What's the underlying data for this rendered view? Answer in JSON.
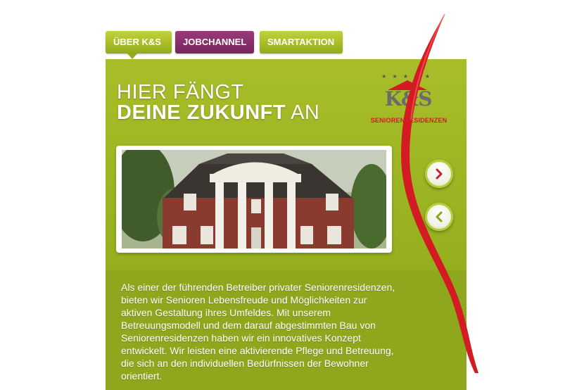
{
  "tabs": [
    {
      "label": "ÜBER K&S",
      "color": "#a5bb2a",
      "active": true
    },
    {
      "label": "JOBCHANNEL",
      "color": "#87306a",
      "active": false
    },
    {
      "label": "SMARTAKTION",
      "color": "#a5bb2a",
      "active": false
    }
  ],
  "headline": {
    "line1": "HIER FÄNGT",
    "line2_bold": "DEINE ZUKUNFT",
    "line2_rest": "AN"
  },
  "logo": {
    "stars": "★ ★ ★ ★ ★",
    "letters": "K&S",
    "subtitle": "SENIORENRESIDENZEN"
  },
  "carousel": {
    "next_icon": "chevron-right-icon",
    "prev_icon": "chevron-left-icon",
    "image": "building-photo"
  },
  "body_text": "Als einer der führenden Betreiber privater Seniorenresidenzen, bieten wir Senioren Lebensfreude und Möglichkeiten zur aktiven Gestaltung ihres Umfeldes. Mit unserem Betreuungsmodell und dem darauf abgestimmten Bau von Seniorenresidenzen haben wir ein innovatives Konzept entwickelt. Wir leisten eine aktivierende Pflege und Betreuung, die sich an den individuellen Bedürfnissen der Bewohner orientiert.",
  "colors": {
    "accent_green": "#9db524",
    "accent_purple": "#87306a",
    "ribbon_red": "#d31b23"
  }
}
